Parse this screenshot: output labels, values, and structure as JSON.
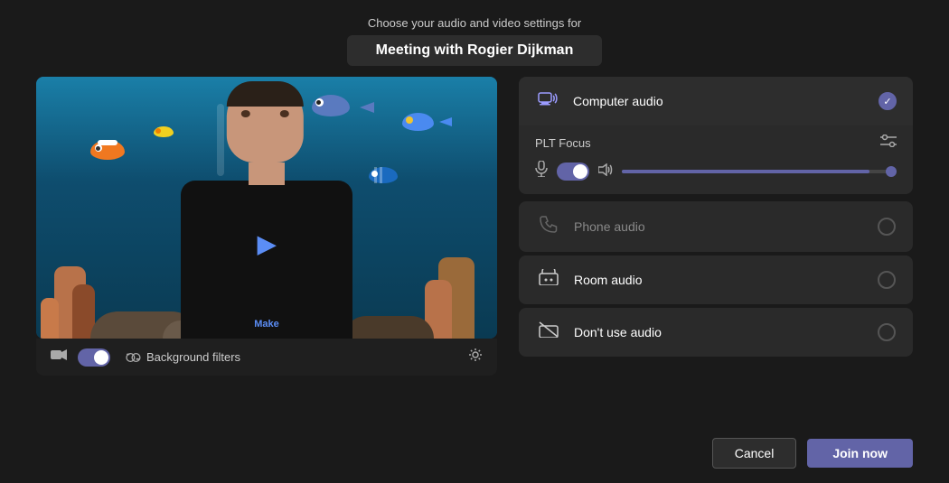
{
  "header": {
    "subtitle": "Choose your audio and video settings for",
    "title": "Meeting with Rogier Dijkman"
  },
  "video_controls": {
    "bg_filters_label": "Background filters"
  },
  "audio": {
    "computer_audio_label": "Computer audio",
    "plt_focus_label": "PLT Focus",
    "phone_audio_label": "Phone audio",
    "room_audio_label": "Room audio",
    "no_audio_label": "Don't use audio"
  },
  "buttons": {
    "cancel_label": "Cancel",
    "join_label": "Join now"
  }
}
